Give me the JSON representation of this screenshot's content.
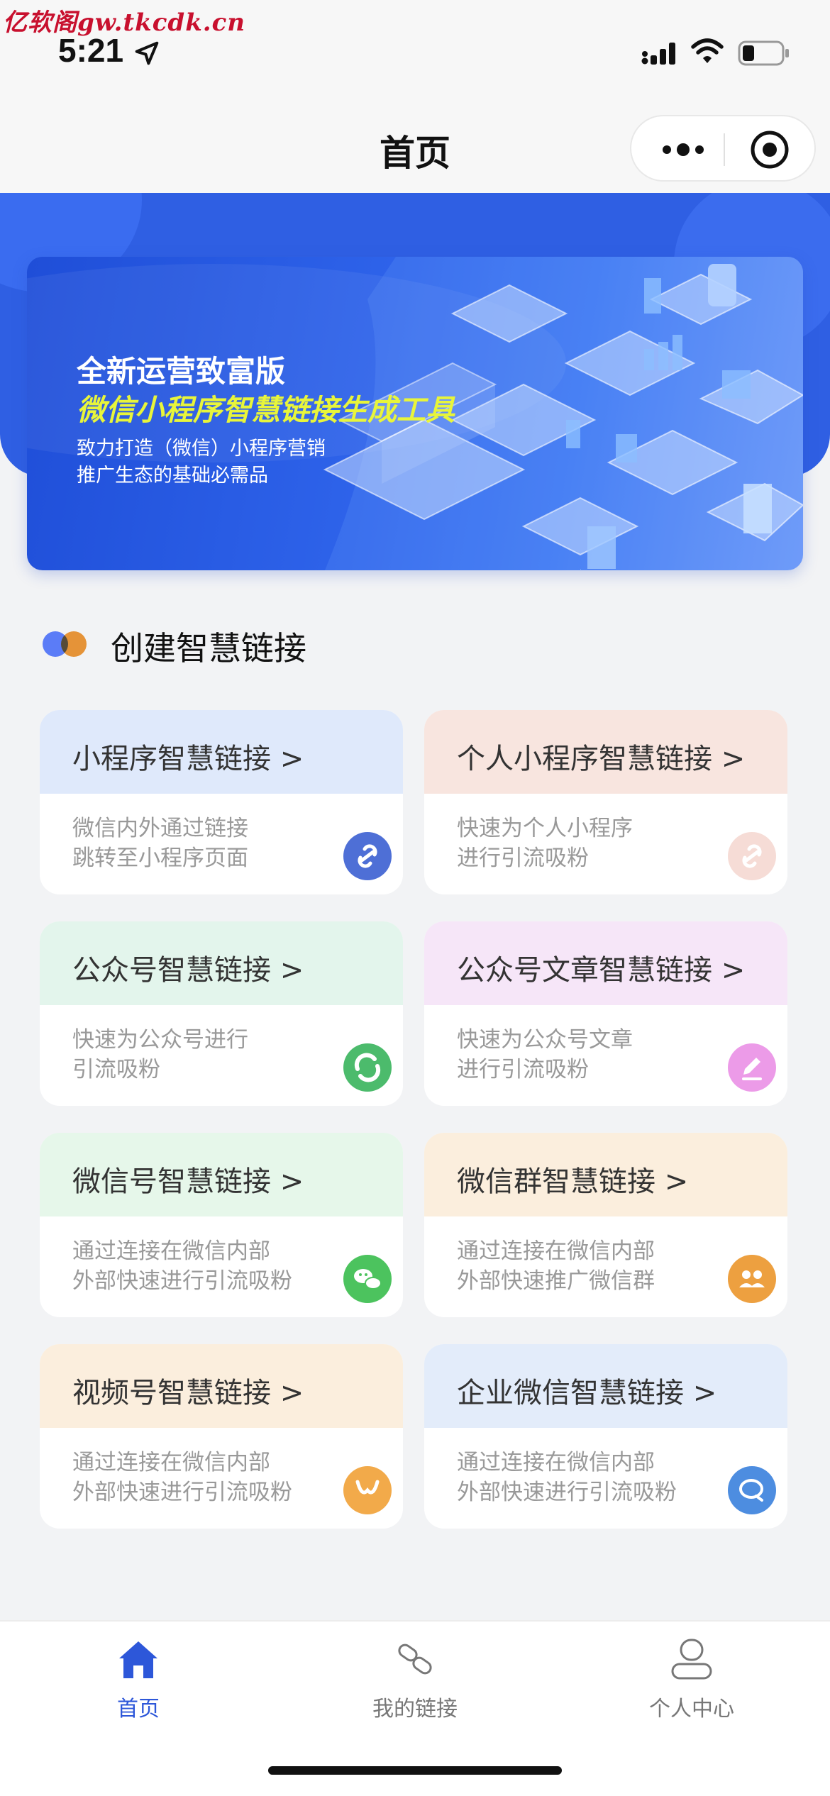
{
  "watermark": "亿软阁gw.tkcdk.cn",
  "status": {
    "time": "5:21"
  },
  "nav": {
    "title": "首页"
  },
  "banner": {
    "title": "全新运营致富版",
    "subtitle": "微信小程序智慧链接生成工具",
    "desc1": "致力打造（微信）小程序营销",
    "desc2": "推广生态的基础必需品"
  },
  "section": {
    "title": "创建智慧链接"
  },
  "cards": [
    {
      "title": "小程序智慧链接 >",
      "desc1": "微信内外通过链接",
      "desc2": "跳转至小程序页面",
      "head_color": "#dfe9fb",
      "icon": "link-icon",
      "icon_color": "#4e6fd6"
    },
    {
      "title": "个人小程序智慧链接 >",
      "desc1": "快速为个人小程序",
      "desc2": "进行引流吸粉",
      "head_color": "#f8e5df",
      "icon": "link-icon",
      "icon_color": "#f6dcd6"
    },
    {
      "title": "公众号智慧链接 >",
      "desc1": "快速为公众号进行",
      "desc2": "引流吸粉",
      "head_color": "#e3f5ec",
      "icon": "official-account-icon",
      "icon_color": "#4cbb6c"
    },
    {
      "title": "公众号文章智慧链接 >",
      "desc1": "快速为公众号文章",
      "desc2": "进行引流吸粉",
      "head_color": "#f6e6f8",
      "icon": "edit-icon",
      "icon_color": "#ec9be8"
    },
    {
      "title": "微信号智慧链接 >",
      "desc1": "通过连接在微信内部",
      "desc2": "外部快速进行引流吸粉",
      "head_color": "#e6f7ea",
      "icon": "wechat-icon",
      "icon_color": "#4cc35e"
    },
    {
      "title": "微信群智慧链接 >",
      "desc1": "通过连接在微信内部",
      "desc2": "外部快速推广微信群",
      "head_color": "#fbeedd",
      "icon": "group-icon",
      "icon_color": "#eda040"
    },
    {
      "title": "视频号智慧链接 >",
      "desc1": "通过连接在微信内部",
      "desc2": "外部快速进行引流吸粉",
      "head_color": "#fbeedd",
      "icon": "channels-icon",
      "icon_color": "#f2aa4a"
    },
    {
      "title": "企业微信智慧链接 >",
      "desc1": "通过连接在微信内部",
      "desc2": "外部快速进行引流吸粉",
      "head_color": "#e3ecfa",
      "icon": "work-wechat-icon",
      "icon_color": "#4d8de0"
    }
  ],
  "tabs": [
    {
      "label": "首页",
      "icon": "home-icon",
      "active": true
    },
    {
      "label": "我的链接",
      "icon": "link-icon",
      "active": false
    },
    {
      "label": "个人中心",
      "icon": "user-icon",
      "active": false
    }
  ],
  "colors": {
    "accent": "#2d57d9",
    "hero": "#2f5fe3",
    "background": "#f2f3f5"
  }
}
